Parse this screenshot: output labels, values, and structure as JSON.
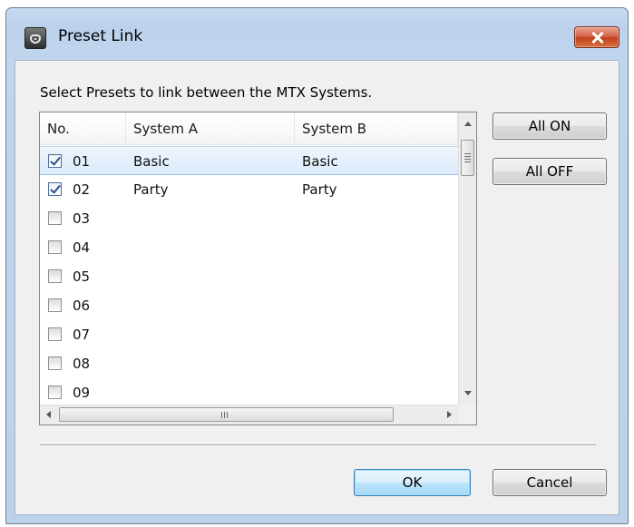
{
  "window": {
    "title": "Preset Link"
  },
  "instruction": "Select Presets to link between the MTX Systems.",
  "table": {
    "columns": [
      "No.",
      "System A",
      "System B"
    ],
    "rows": [
      {
        "no": "01",
        "checked": true,
        "system_a": "Basic",
        "system_b": "Basic",
        "selected": true
      },
      {
        "no": "02",
        "checked": true,
        "system_a": "Party",
        "system_b": "Party",
        "selected": false
      },
      {
        "no": "03",
        "checked": false,
        "system_a": "",
        "system_b": "",
        "selected": false
      },
      {
        "no": "04",
        "checked": false,
        "system_a": "",
        "system_b": "",
        "selected": false
      },
      {
        "no": "05",
        "checked": false,
        "system_a": "",
        "system_b": "",
        "selected": false
      },
      {
        "no": "06",
        "checked": false,
        "system_a": "",
        "system_b": "",
        "selected": false
      },
      {
        "no": "07",
        "checked": false,
        "system_a": "",
        "system_b": "",
        "selected": false
      },
      {
        "no": "08",
        "checked": false,
        "system_a": "",
        "system_b": "",
        "selected": false
      },
      {
        "no": "09",
        "checked": false,
        "system_a": "",
        "system_b": "",
        "selected": false
      }
    ]
  },
  "side_buttons": {
    "all_on": "All ON",
    "all_off": "All OFF"
  },
  "footer": {
    "ok": "OK",
    "cancel": "Cancel"
  },
  "icons": {
    "app": "app-icon",
    "close": "close-icon",
    "scroll_up": "arrow-up-icon",
    "scroll_down": "arrow-down-icon",
    "scroll_left": "arrow-left-icon",
    "scroll_right": "arrow-right-icon"
  },
  "colors": {
    "title_bar": "#bcd2ec",
    "close_button": "#c7432a",
    "selection": "#dcebfb",
    "default_button": "#bee6fd"
  }
}
